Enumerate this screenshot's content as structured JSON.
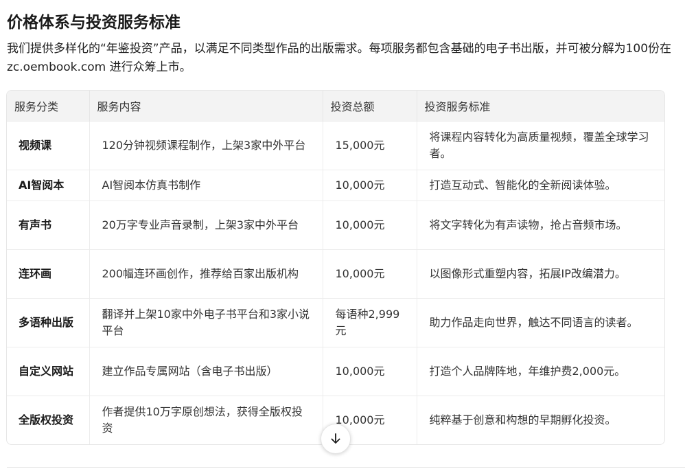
{
  "heading": "价格体系与投资服务标准",
  "intro": "我们提供多样化的“年鉴投资”产品，以满足不同类型作品的出版需求。每项服务都包含基础的电子书出版，并可被分解为100份在 zc.oembook.com 进行众筹上市。",
  "table": {
    "headers": [
      "服务分类",
      "服务内容",
      "投资总额",
      "投资服务标准"
    ],
    "rows": [
      {
        "category": "视频课",
        "content": "120分钟视频课程制作，上架3家中外平台",
        "amount": "15,000元",
        "standard": "将课程内容转化为高质量视频，覆盖全球学习者。"
      },
      {
        "category": "AI智阅本",
        "content": "AI智阅本仿真书制作",
        "amount": "10,000元",
        "standard": "打造互动式、智能化的全新阅读体验。"
      },
      {
        "category": "有声书",
        "content": "20万字专业声音录制，上架3家中外平台",
        "amount": "10,000元",
        "standard": "将文字转化为有声读物，抢占音频市场。"
      },
      {
        "category": "连环画",
        "content": "200幅连环画创作，推荐给百家出版机构",
        "amount": "10,000元",
        "standard": "以图像形式重塑内容，拓展IP改编潜力。"
      },
      {
        "category": "多语种出版",
        "content": "翻译并上架10家中外电子书平台和3家小说平台",
        "amount": "每语种2,999元",
        "standard": "助力作品走向世界，触达不同语言的读者。"
      },
      {
        "category": "自定义网站",
        "content": "建立作品专属网站（含电子书出版）",
        "amount": "10,000元",
        "standard": "打造个人品牌阵地，年维护费2,000元。"
      },
      {
        "category": "全版权投资",
        "content": "作者提供10万字原创想法，获得全版权投资",
        "amount": "10,000元",
        "standard": "纯粹基于创意和构想的早期孵化投资。"
      }
    ]
  },
  "icons": {
    "scroll_down": "arrow-down-icon"
  }
}
